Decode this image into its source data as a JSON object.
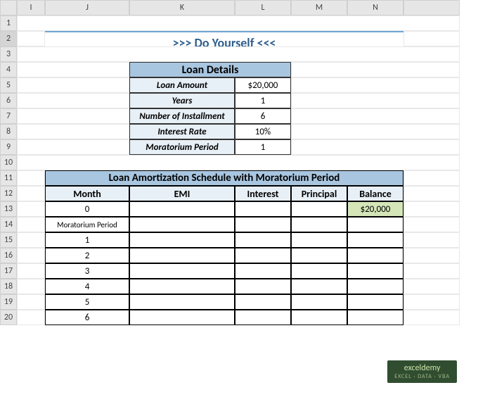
{
  "columns": [
    "",
    "I",
    "J",
    "K",
    "L",
    "M",
    "N",
    ""
  ],
  "rows": [
    "1",
    "2",
    "3",
    "4",
    "5",
    "6",
    "7",
    "8",
    "9",
    "10",
    "11",
    "12",
    "13",
    "14",
    "15",
    "16",
    "17",
    "18",
    "19",
    "20"
  ],
  "banner": ">>> Do Yourself <<<",
  "loan": {
    "title": "Loan Details",
    "rows": [
      {
        "label": "Loan Amount",
        "value": "$20,000"
      },
      {
        "label": "Years",
        "value": "1"
      },
      {
        "label": "Number of Installment",
        "value": "6"
      },
      {
        "label": "Interest Rate",
        "value": "10%"
      },
      {
        "label": "Moratorium Period",
        "value": "1"
      }
    ]
  },
  "schedule": {
    "title": "Loan Amortization Schedule with Moratorium Period",
    "headers": [
      "Month",
      "EMI",
      "Interest",
      "Principal",
      "Balance"
    ],
    "rows": [
      {
        "month": "0",
        "emi": "",
        "interest": "",
        "principal": "",
        "balance": "$20,000",
        "hl": true
      },
      {
        "month": "Moratorium Period",
        "emi": "",
        "interest": "",
        "principal": "",
        "balance": ""
      },
      {
        "month": "1",
        "emi": "",
        "interest": "",
        "principal": "",
        "balance": ""
      },
      {
        "month": "2",
        "emi": "",
        "interest": "",
        "principal": "",
        "balance": ""
      },
      {
        "month": "3",
        "emi": "",
        "interest": "",
        "principal": "",
        "balance": ""
      },
      {
        "month": "4",
        "emi": "",
        "interest": "",
        "principal": "",
        "balance": ""
      },
      {
        "month": "5",
        "emi": "",
        "interest": "",
        "principal": "",
        "balance": ""
      },
      {
        "month": "6",
        "emi": "",
        "interest": "",
        "principal": "",
        "balance": ""
      }
    ]
  },
  "watermark": {
    "main": "exceldemy",
    "sub": "EXCEL · DATA · VBA"
  }
}
